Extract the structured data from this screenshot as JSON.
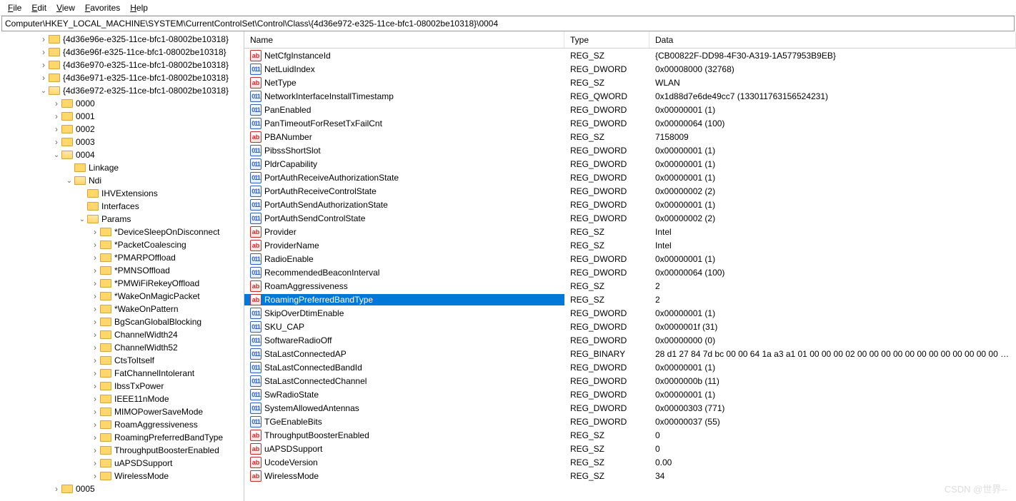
{
  "menu": {
    "file": "File",
    "edit": "Edit",
    "view": "View",
    "favorites": "Favorites",
    "help": "Help"
  },
  "addressbar": {
    "path": "Computer\\HKEY_LOCAL_MACHINE\\SYSTEM\\CurrentControlSet\\Control\\Class\\{4d36e972-e325-11ce-bfc1-08002be10318}\\0004"
  },
  "cols": {
    "name": "Name",
    "type": "Type",
    "data": "Data"
  },
  "tree": [
    {
      "d": 3,
      "t": "closed",
      "f": "closed",
      "label": "{4d36e96e-e325-11ce-bfc1-08002be10318}"
    },
    {
      "d": 3,
      "t": "closed",
      "f": "closed",
      "label": "{4d36e96f-e325-11ce-bfc1-08002be10318}"
    },
    {
      "d": 3,
      "t": "closed",
      "f": "closed",
      "label": "{4d36e970-e325-11ce-bfc1-08002be10318}"
    },
    {
      "d": 3,
      "t": "closed",
      "f": "closed",
      "label": "{4d36e971-e325-11ce-bfc1-08002be10318}"
    },
    {
      "d": 3,
      "t": "open",
      "f": "open",
      "label": "{4d36e972-e325-11ce-bfc1-08002be10318}"
    },
    {
      "d": 4,
      "t": "closed",
      "f": "closed",
      "label": "0000"
    },
    {
      "d": 4,
      "t": "closed",
      "f": "closed",
      "label": "0001"
    },
    {
      "d": 4,
      "t": "closed",
      "f": "closed",
      "label": "0002"
    },
    {
      "d": 4,
      "t": "closed",
      "f": "closed",
      "label": "0003"
    },
    {
      "d": 4,
      "t": "open",
      "f": "open",
      "label": "0004"
    },
    {
      "d": 5,
      "t": "none",
      "f": "closed",
      "label": "Linkage"
    },
    {
      "d": 5,
      "t": "open",
      "f": "open",
      "label": "Ndi"
    },
    {
      "d": 6,
      "t": "none",
      "f": "closed",
      "label": "IHVExtensions"
    },
    {
      "d": 6,
      "t": "none",
      "f": "closed",
      "label": "Interfaces"
    },
    {
      "d": 6,
      "t": "open",
      "f": "open",
      "label": "Params"
    },
    {
      "d": 7,
      "t": "closed",
      "f": "closed",
      "label": "*DeviceSleepOnDisconnect"
    },
    {
      "d": 7,
      "t": "closed",
      "f": "closed",
      "label": "*PacketCoalescing"
    },
    {
      "d": 7,
      "t": "closed",
      "f": "closed",
      "label": "*PMARPOffload"
    },
    {
      "d": 7,
      "t": "closed",
      "f": "closed",
      "label": "*PMNSOffload"
    },
    {
      "d": 7,
      "t": "closed",
      "f": "closed",
      "label": "*PMWiFiRekeyOffload"
    },
    {
      "d": 7,
      "t": "closed",
      "f": "closed",
      "label": "*WakeOnMagicPacket"
    },
    {
      "d": 7,
      "t": "closed",
      "f": "closed",
      "label": "*WakeOnPattern"
    },
    {
      "d": 7,
      "t": "closed",
      "f": "closed",
      "label": "BgScanGlobalBlocking"
    },
    {
      "d": 7,
      "t": "closed",
      "f": "closed",
      "label": "ChannelWidth24"
    },
    {
      "d": 7,
      "t": "closed",
      "f": "closed",
      "label": "ChannelWidth52"
    },
    {
      "d": 7,
      "t": "closed",
      "f": "closed",
      "label": "CtsToItself"
    },
    {
      "d": 7,
      "t": "closed",
      "f": "closed",
      "label": "FatChannelIntolerant"
    },
    {
      "d": 7,
      "t": "closed",
      "f": "closed",
      "label": "IbssTxPower"
    },
    {
      "d": 7,
      "t": "closed",
      "f": "closed",
      "label": "IEEE11nMode"
    },
    {
      "d": 7,
      "t": "closed",
      "f": "closed",
      "label": "MIMOPowerSaveMode"
    },
    {
      "d": 7,
      "t": "closed",
      "f": "closed",
      "label": "RoamAggressiveness"
    },
    {
      "d": 7,
      "t": "closed",
      "f": "closed",
      "label": "RoamingPreferredBandType"
    },
    {
      "d": 7,
      "t": "closed",
      "f": "closed",
      "label": "ThroughputBoosterEnabled"
    },
    {
      "d": 7,
      "t": "closed",
      "f": "closed",
      "label": "uAPSDSupport"
    },
    {
      "d": 7,
      "t": "closed",
      "f": "closed",
      "label": "WirelessMode"
    },
    {
      "d": 4,
      "t": "closed",
      "f": "closed",
      "label": "0005"
    }
  ],
  "values": [
    {
      "icon": "ab",
      "name": "NetCfgInstanceId",
      "type": "REG_SZ",
      "data": "{CB00822F-DD98-4F30-A319-1A577953B9EB}"
    },
    {
      "icon": "bin",
      "name": "NetLuidIndex",
      "type": "REG_DWORD",
      "data": "0x00008000 (32768)"
    },
    {
      "icon": "ab",
      "name": "NetType",
      "type": "REG_SZ",
      "data": "WLAN"
    },
    {
      "icon": "bin",
      "name": "NetworkInterfaceInstallTimestamp",
      "type": "REG_QWORD",
      "data": "0x1d88d7e6de49cc7 (133011763156524231)"
    },
    {
      "icon": "bin",
      "name": "PanEnabled",
      "type": "REG_DWORD",
      "data": "0x00000001 (1)"
    },
    {
      "icon": "bin",
      "name": "PanTimeoutForResetTxFailCnt",
      "type": "REG_DWORD",
      "data": "0x00000064 (100)"
    },
    {
      "icon": "ab",
      "name": "PBANumber",
      "type": "REG_SZ",
      "data": "7158009"
    },
    {
      "icon": "bin",
      "name": "PibssShortSlot",
      "type": "REG_DWORD",
      "data": "0x00000001 (1)"
    },
    {
      "icon": "bin",
      "name": "PldrCapability",
      "type": "REG_DWORD",
      "data": "0x00000001 (1)"
    },
    {
      "icon": "bin",
      "name": "PortAuthReceiveAuthorizationState",
      "type": "REG_DWORD",
      "data": "0x00000001 (1)"
    },
    {
      "icon": "bin",
      "name": "PortAuthReceiveControlState",
      "type": "REG_DWORD",
      "data": "0x00000002 (2)"
    },
    {
      "icon": "bin",
      "name": "PortAuthSendAuthorizationState",
      "type": "REG_DWORD",
      "data": "0x00000001 (1)"
    },
    {
      "icon": "bin",
      "name": "PortAuthSendControlState",
      "type": "REG_DWORD",
      "data": "0x00000002 (2)"
    },
    {
      "icon": "ab",
      "name": "Provider",
      "type": "REG_SZ",
      "data": "Intel"
    },
    {
      "icon": "ab",
      "name": "ProviderName",
      "type": "REG_SZ",
      "data": "Intel"
    },
    {
      "icon": "bin",
      "name": "RadioEnable",
      "type": "REG_DWORD",
      "data": "0x00000001 (1)"
    },
    {
      "icon": "bin",
      "name": "RecommendedBeaconInterval",
      "type": "REG_DWORD",
      "data": "0x00000064 (100)"
    },
    {
      "icon": "ab",
      "name": "RoamAggressiveness",
      "type": "REG_SZ",
      "data": "2"
    },
    {
      "icon": "ab",
      "name": "RoamingPreferredBandType",
      "type": "REG_SZ",
      "data": "2",
      "selected": true
    },
    {
      "icon": "bin",
      "name": "SkipOverDtimEnable",
      "type": "REG_DWORD",
      "data": "0x00000001 (1)"
    },
    {
      "icon": "bin",
      "name": "SKU_CAP",
      "type": "REG_DWORD",
      "data": "0x0000001f (31)"
    },
    {
      "icon": "bin",
      "name": "SoftwareRadioOff",
      "type": "REG_DWORD",
      "data": "0x00000000 (0)"
    },
    {
      "icon": "bin",
      "name": "StaLastConnectedAP",
      "type": "REG_BINARY",
      "data": "28 d1 27 84 7d bc 00 00 64 1a a3 a1 01 00 00 00 02 00 00 00 00 00 00 00 00 00 00 00 00 00 00 00 0"
    },
    {
      "icon": "bin",
      "name": "StaLastConnectedBandId",
      "type": "REG_DWORD",
      "data": "0x00000001 (1)"
    },
    {
      "icon": "bin",
      "name": "StaLastConnectedChannel",
      "type": "REG_DWORD",
      "data": "0x0000000b (11)"
    },
    {
      "icon": "bin",
      "name": "SwRadioState",
      "type": "REG_DWORD",
      "data": "0x00000001 (1)"
    },
    {
      "icon": "bin",
      "name": "SystemAllowedAntennas",
      "type": "REG_DWORD",
      "data": "0x00000303 (771)"
    },
    {
      "icon": "bin",
      "name": "TGeEnableBits",
      "type": "REG_DWORD",
      "data": "0x00000037 (55)"
    },
    {
      "icon": "ab",
      "name": "ThroughputBoosterEnabled",
      "type": "REG_SZ",
      "data": "0"
    },
    {
      "icon": "ab",
      "name": "uAPSDSupport",
      "type": "REG_SZ",
      "data": "0"
    },
    {
      "icon": "ab",
      "name": "UcodeVersion",
      "type": "REG_SZ",
      "data": "0.00"
    },
    {
      "icon": "ab",
      "name": "WirelessMode",
      "type": "REG_SZ",
      "data": "34"
    }
  ],
  "watermark": "CSDN @世界--"
}
